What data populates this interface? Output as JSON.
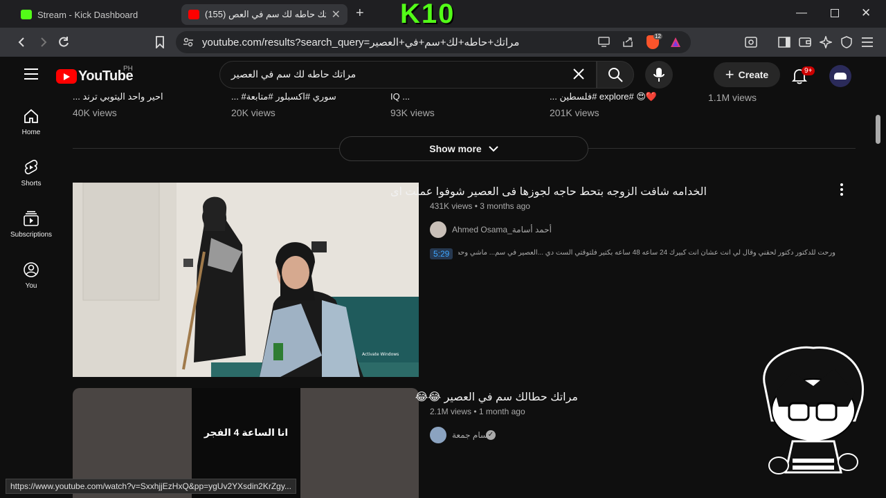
{
  "browser": {
    "tabs": [
      {
        "title": "Stream - Kick Dashboard",
        "active": false
      },
      {
        "title": "(155) مراتك حاطه لك سم في العص",
        "active": true
      }
    ],
    "new_tab": "+",
    "overlay_logo": "K10",
    "url": "youtube.com/results?search_query=مراتك+حاطه+لك+سم+في+العصير",
    "shield_badge": "12",
    "colors": {
      "kick_green": "#53fc18",
      "youtube_red": "#ff0000"
    }
  },
  "youtube": {
    "logo_text": "YouTube",
    "region": "PH",
    "search": {
      "value": "مراتك حاطه لك سم في العصير"
    },
    "create_label": "Create",
    "notif_badge": "9+",
    "sidebar": [
      {
        "label": "Home",
        "icon": "home-icon"
      },
      {
        "label": "Shorts",
        "icon": "shorts-icon"
      },
      {
        "label": "Subscriptions",
        "icon": "subscriptions-icon"
      },
      {
        "label": "You",
        "icon": "you-icon"
      }
    ],
    "shorts_row": [
      {
        "title": "... احير واحد اليتوبي ترند",
        "views": "40K views"
      },
      {
        "title": "... #سوري #اكسبلور #متابعة",
        "views": "20K views"
      },
      {
        "title": "IQ ...",
        "views": "93K views"
      },
      {
        "title": "... فلسطين# explore# 😍❤️",
        "views": "201K views"
      },
      {
        "title": "",
        "views": "1.1M views"
      }
    ],
    "show_more": "Show more",
    "videos": [
      {
        "title": "الخدامه شافت الزوجه بتحط حاجه لجوزها فى العصير شوفوا عملت اى",
        "views": "431K views",
        "age": "3 months ago",
        "channel": "Ahmed Osama_أحمد أسامة",
        "snippet": "ورحت للدكتور دكتور لحقني وقال لي انت عشان انت كبيرك 24 ساعه 48 ساعه بكتير فلتوقتي الست دي ...العصير في سم... ماشي وحطيت لي",
        "duration": "5:29"
      },
      {
        "title": "مراتك حطالك سم في العصير 😂😂",
        "views": "2.1M views",
        "age": "1 month ago",
        "channel": "حسام جمعة",
        "thumb_text": "انا الساعة 4 الفجر"
      }
    ],
    "status_url": "https://www.youtube.com/watch?v=SxxhjjEzHxQ&pp=ygUv2YXsdin2KrZgy..."
  }
}
